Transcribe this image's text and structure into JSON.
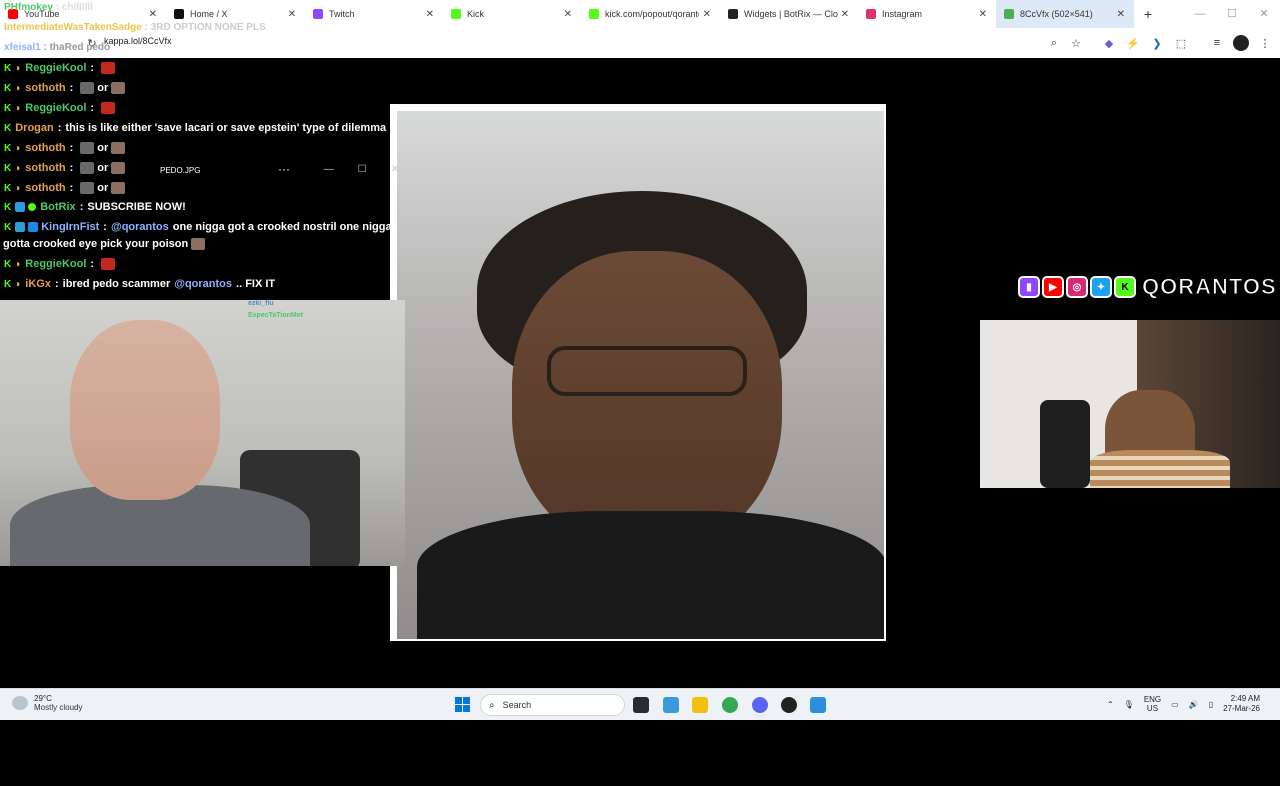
{
  "browser": {
    "tabs": [
      {
        "title": "YouTube",
        "color": "#ff0000"
      },
      {
        "title": "Home / X",
        "color": "#111111"
      },
      {
        "title": "Twitch",
        "color": "#9146ff"
      },
      {
        "title": "Kick",
        "color": "#53fc18"
      },
      {
        "title": "kick.com/popout/qorantos",
        "color": "#53fc18"
      },
      {
        "title": "Widgets | BotRix — Cloud",
        "color": "#222222"
      },
      {
        "title": "Instagram",
        "color": "#e1306c"
      },
      {
        "title": "8CcVfx (502×541)",
        "color": "#4caf50",
        "active": true
      }
    ],
    "url": "kappa.lol/8CcVfx"
  },
  "chat_overlay_top": [
    {
      "user": "PHfmokey",
      "text": "chillllll"
    },
    {
      "user": "IntermediateWasTakenSadge",
      "text": "3RD OPTION NONE PLS"
    },
    {
      "user": "xfeisal1",
      "text": "thaRed pedo"
    }
  ],
  "chat": [
    {
      "user": "ReggieKool",
      "user_color": "green",
      "badge": "b",
      "sep": ":",
      "text": "",
      "emotes": [
        "red"
      ]
    },
    {
      "user": "sothoth",
      "user_color": "orange",
      "badge": "b",
      "sep": ":",
      "text": "or",
      "emotes": [
        "gray",
        "face"
      ]
    },
    {
      "user": "ReggieKool",
      "user_color": "green",
      "badge": "b",
      "sep": ":",
      "text": "",
      "emotes": [
        "red"
      ]
    },
    {
      "user": "Drogan",
      "user_color": "orange",
      "badge": "",
      "sep": ":",
      "text": "this is like either 'save lacari or save epstein' type of dilemma",
      "emotes": []
    },
    {
      "user": "sothoth",
      "user_color": "orange",
      "badge": "b",
      "sep": ":",
      "text": "or",
      "emotes": [
        "gray",
        "face"
      ]
    },
    {
      "user": "sothoth",
      "user_color": "orange",
      "badge": "b",
      "sep": ":",
      "text": "or",
      "emotes": [
        "gray",
        "face"
      ]
    },
    {
      "user": "sothoth",
      "user_color": "orange",
      "badge": "b",
      "sep": ":",
      "text": "or",
      "emotes": [
        "gray",
        "face"
      ]
    },
    {
      "user": "BotRix",
      "user_color": "green",
      "badge": "bot",
      "sep": ":",
      "text": "SUBSCRIBE NOW!",
      "emotes": []
    },
    {
      "user": "KingIrnFist",
      "user_color": "blue",
      "badge": "bot",
      "sep": ":",
      "mention": "@qorantos",
      "text": "one nigga got a crooked nostril one nigga",
      "emotes": []
    },
    {
      "user": "",
      "user_color": "",
      "badge": "",
      "sep": "",
      "text": "gotta crooked eye pick your poison",
      "emotes": [
        "face"
      ]
    },
    {
      "user": "ReggieKool",
      "user_color": "green",
      "badge": "b",
      "sep": ":",
      "text": "",
      "emotes": [
        "red"
      ]
    },
    {
      "user": "iKGx",
      "user_color": "orange",
      "badge": "b",
      "sep": ":",
      "text": "ibred pedo scammer",
      "mention2": "@qorantos",
      "text2": ".. FIX IT",
      "emotes": []
    }
  ],
  "popup": {
    "title": "PEDO.JPG",
    "more": "···",
    "minimize": "—",
    "maximize": "☐",
    "close": "✕"
  },
  "cam_left_overlay": {
    "line1": "ezki_flu",
    "line2": "ExpecTaTionMet"
  },
  "brand": {
    "name": "QORANTOS"
  },
  "taskbar": {
    "weather_temp": "29°C",
    "weather_desc": "Mostly cloudy",
    "search_label": "Search",
    "lang_top": "ENG",
    "lang_bottom": "US",
    "time": "2:49 AM",
    "date": "27-Mar-26"
  }
}
